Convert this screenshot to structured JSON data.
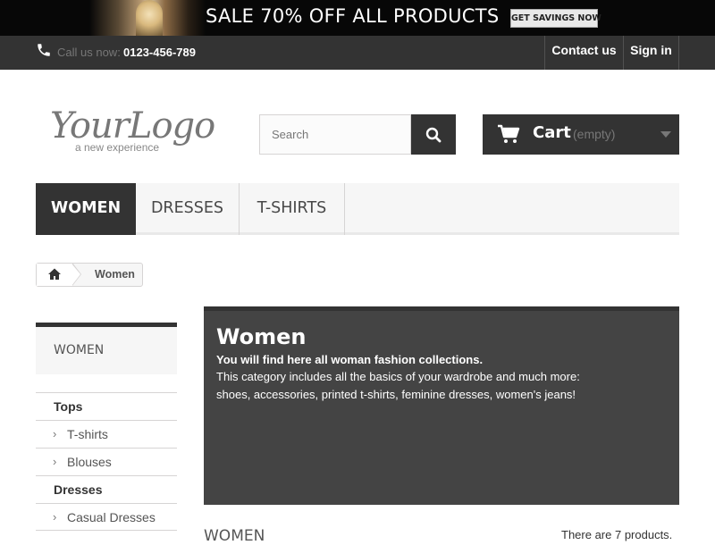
{
  "promo": {
    "headline": "SALE 70% OFF ALL PRODUCTS",
    "cta": "GET SAVINGS NOW"
  },
  "topnav": {
    "call_label": "Call us now:",
    "phone": "0123-456-789",
    "contact": "Contact us",
    "signin": "Sign in"
  },
  "logo": {
    "text": "YourLogo",
    "tagline": "a new experience"
  },
  "search": {
    "placeholder": "Search"
  },
  "cart": {
    "label": "Cart",
    "status": "(empty)"
  },
  "menu": {
    "tabs": [
      "WOMEN",
      "DRESSES",
      "T-SHIRTS"
    ],
    "active": "WOMEN"
  },
  "breadcrumb": {
    "current": "Women"
  },
  "sidebar": {
    "title": "WOMEN",
    "items": [
      {
        "label": "Tops",
        "level": "parent"
      },
      {
        "label": "T-shirts",
        "level": "child"
      },
      {
        "label": "Blouses",
        "level": "child"
      },
      {
        "label": "Dresses",
        "level": "parent"
      },
      {
        "label": "Casual Dresses",
        "level": "child"
      }
    ]
  },
  "category": {
    "title": "Women",
    "lead": "You will find here all woman fashion collections.",
    "desc_line1": "This category includes all the basics of your wardrobe and much more:",
    "desc_line2": "shoes, accessories, printed t-shirts, feminine dresses, women's jeans!"
  },
  "listing": {
    "heading": "WOMEN",
    "count": "There are 7 products."
  },
  "colors": {
    "dark": "#333333",
    "banner": "#444444",
    "light_bg": "#f6f6f6"
  }
}
